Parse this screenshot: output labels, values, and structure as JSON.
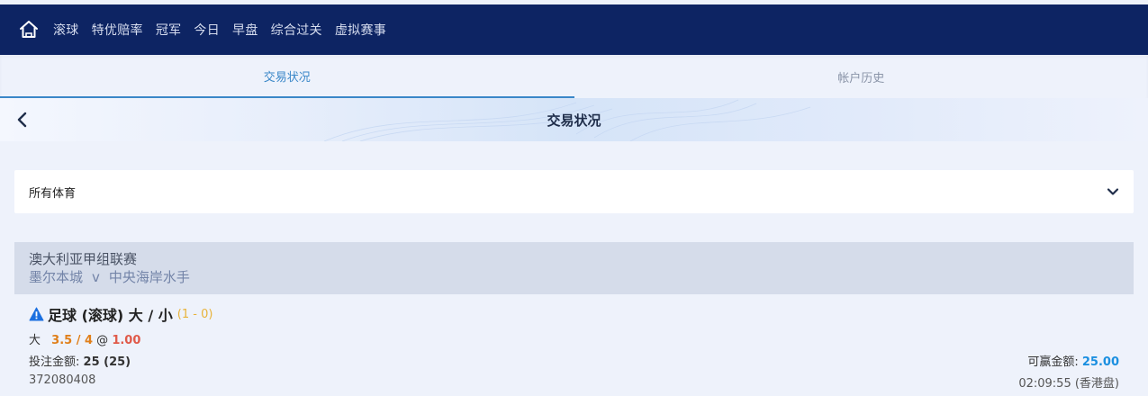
{
  "nav": {
    "home_icon": "home-icon",
    "items": [
      "滚球",
      "特优赔率",
      "冠军",
      "今日",
      "早盘",
      "综合过关",
      "虚拟赛事"
    ]
  },
  "tabs": [
    {
      "label": "交易状况",
      "active": true
    },
    {
      "label": "帐户历史",
      "active": false
    }
  ],
  "subheader": {
    "title": "交易状况",
    "back_icon": "chevron-left-icon"
  },
  "filter": {
    "label": "所有体育",
    "icon": "chevron-down-icon"
  },
  "league": {
    "name": "澳大利亚甲组联赛",
    "home_team": "墨尔本城",
    "vs": "v",
    "away_team": "中央海岸水手"
  },
  "bet": {
    "warning_icon": "warning-icon",
    "title": "足球 (滚球) 大 / 小",
    "score": "(1 - 0)",
    "selection": "大",
    "handicap": "3.5 / 4",
    "at": "@",
    "odds": "1.00",
    "stake_label": "投注金额:",
    "stake_value": "25 (25)",
    "ticket_id": "372080408",
    "win_label": "可赢金额:",
    "win_value": "25.00",
    "time": "02:09:55 (香港盘)"
  },
  "colors": {
    "topbar": "#0d2463",
    "accent": "#3a87c8",
    "handicap": "#e07f1a",
    "odds": "#e05a4a",
    "win": "#1a8fe0"
  }
}
